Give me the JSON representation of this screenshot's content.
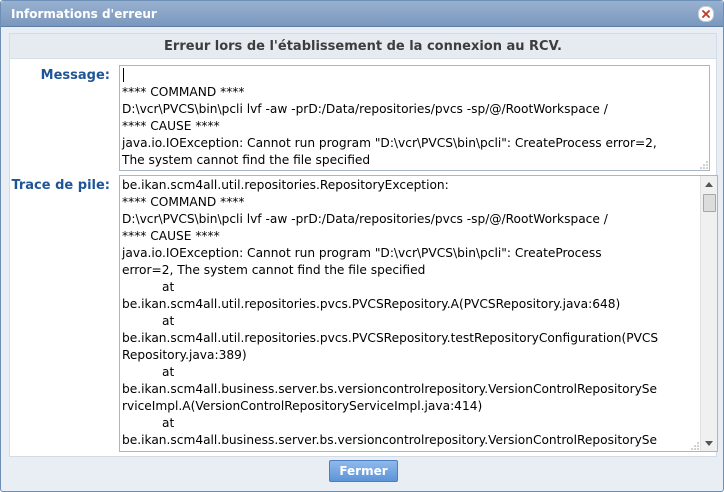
{
  "dialog": {
    "title": "Informations d'erreur",
    "header": "Erreur lors de l'établissement de la connexion au RCV.",
    "message_label": "Message:",
    "stack_label": "Trace de pile:",
    "close_button": "Fermer"
  },
  "message_lines": [
    "",
    "**** COMMAND ****",
    "D:\\vcr\\PVCS\\bin\\pcli lvf -aw -prD:/Data/repositories/pvcs -sp/@/RootWorkspace /",
    "**** CAUSE ****",
    "java.io.IOException: Cannot run program \"D:\\vcr\\PVCS\\bin\\pcli\": CreateProcess error=2,",
    "The system cannot find the file specified"
  ],
  "stack_lines": [
    "be.ikan.scm4all.util.repositories.RepositoryException:",
    "**** COMMAND ****",
    "D:\\vcr\\PVCS\\bin\\pcli lvf -aw -prD:/Data/repositories/pvcs -sp/@/RootWorkspace /",
    "**** CAUSE ****",
    "java.io.IOException: Cannot run program \"D:\\vcr\\PVCS\\bin\\pcli\": CreateProcess",
    "error=2, The system cannot find the file specified",
    "\tat",
    "be.ikan.scm4all.util.repositories.pvcs.PVCSRepository.A(PVCSRepository.java:648)",
    "\tat",
    "be.ikan.scm4all.util.repositories.pvcs.PVCSRepository.testRepositoryConfiguration(PVCS",
    "Repository.java:389)",
    "\tat",
    "be.ikan.scm4all.business.server.bs.versioncontrolrepository.VersionControlRepositorySe",
    "rviceImpl.A(VersionControlRepositoryServiceImpl.java:414)",
    "\tat",
    "be.ikan.scm4all.business.server.bs.versioncontrolrepository.VersionControlRepositorySe"
  ],
  "icons": {
    "close": "close-icon",
    "scroll_up": "arrow-up-icon",
    "scroll_down": "arrow-down-icon",
    "resize": "resize-grip-icon"
  },
  "colors": {
    "titlebar": "#7a97bd",
    "label": "#1f5596",
    "button": "#5d94d8"
  }
}
